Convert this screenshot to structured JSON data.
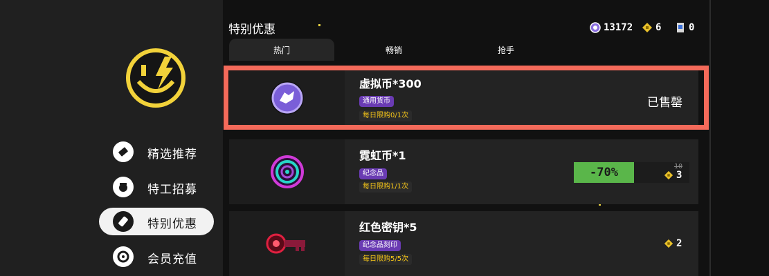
{
  "nav": {
    "items": [
      {
        "label": "精选推荐",
        "icon": "ticket-icon"
      },
      {
        "label": "特工招募",
        "icon": "agent-icon"
      },
      {
        "label": "特别优惠",
        "icon": "tag-icon"
      },
      {
        "label": "会员充值",
        "icon": "coin-icon"
      }
    ],
    "active_index": 2,
    "logo_icon": "smiley-lightning-logo-icon"
  },
  "header": {
    "title": "特别优惠",
    "currencies": [
      {
        "icon": "purple-coin-icon",
        "value": "13172"
      },
      {
        "icon": "gold-gem-icon",
        "value": "6"
      },
      {
        "icon": "ticket-card-icon",
        "value": "0"
      }
    ]
  },
  "tabs": [
    {
      "label": "热门",
      "active": true
    },
    {
      "label": "畅销",
      "active": false
    },
    {
      "label": "抢手",
      "active": false
    }
  ],
  "items": [
    {
      "name": "虚拟币*300",
      "tag": "通用货币",
      "limit": "每日限购0/1次",
      "icon": "virtual-coin-icon",
      "status": "已售罄",
      "selected": true
    },
    {
      "name": "霓虹币*1",
      "tag": "纪念品",
      "limit": "每日限购1/1次",
      "icon": "neon-coin-icon",
      "discount": "-70%",
      "old_price": "10",
      "price": "3",
      "price_icon": "gold-gem-icon"
    },
    {
      "name": "红色密钥*5",
      "tag": "纪念品刻印",
      "limit": "每日限购5/5次",
      "icon": "red-key-icon",
      "price": "2",
      "price_icon": "gold-gem-icon"
    }
  ],
  "colors": {
    "selection_frame": "#f46a5a",
    "tag_purple": "#6a3bb3",
    "discount_green": "#5ab64a",
    "gold": "#f5c518"
  }
}
